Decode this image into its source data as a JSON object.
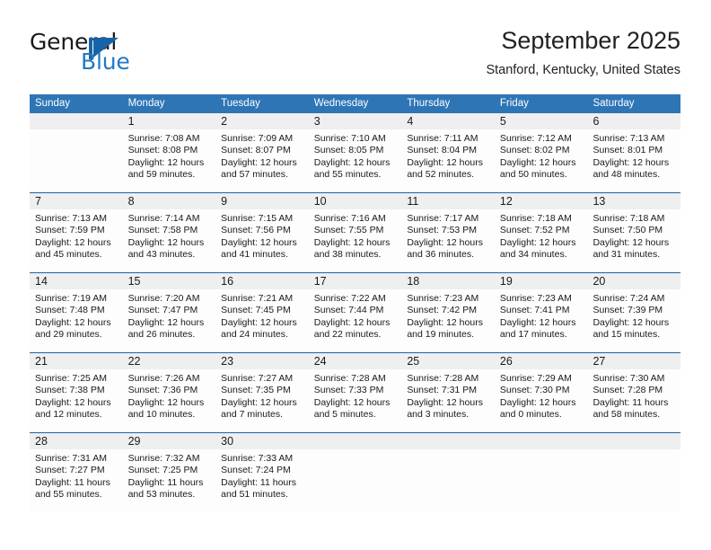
{
  "brand": {
    "name_top": "General",
    "name_bottom": "Blue",
    "accent_color": "#1f7ac4",
    "logo_icon": "blue-triangle-flag-icon"
  },
  "header": {
    "month_title": "September 2025",
    "location": "Stanford, Kentucky, United States"
  },
  "calendar": {
    "header_color": "#2e75b6",
    "daynum_band_color": "#efefef",
    "week_separator_color": "#2360a5",
    "weekdays": [
      "Sunday",
      "Monday",
      "Tuesday",
      "Wednesday",
      "Thursday",
      "Friday",
      "Saturday"
    ],
    "weeks": [
      {
        "days": [
          {
            "num": "",
            "sunrise": "",
            "sunset": "",
            "daylight": ""
          },
          {
            "num": "1",
            "sunrise": "Sunrise: 7:08 AM",
            "sunset": "Sunset: 8:08 PM",
            "daylight": "Daylight: 12 hours and 59 minutes."
          },
          {
            "num": "2",
            "sunrise": "Sunrise: 7:09 AM",
            "sunset": "Sunset: 8:07 PM",
            "daylight": "Daylight: 12 hours and 57 minutes."
          },
          {
            "num": "3",
            "sunrise": "Sunrise: 7:10 AM",
            "sunset": "Sunset: 8:05 PM",
            "daylight": "Daylight: 12 hours and 55 minutes."
          },
          {
            "num": "4",
            "sunrise": "Sunrise: 7:11 AM",
            "sunset": "Sunset: 8:04 PM",
            "daylight": "Daylight: 12 hours and 52 minutes."
          },
          {
            "num": "5",
            "sunrise": "Sunrise: 7:12 AM",
            "sunset": "Sunset: 8:02 PM",
            "daylight": "Daylight: 12 hours and 50 minutes."
          },
          {
            "num": "6",
            "sunrise": "Sunrise: 7:13 AM",
            "sunset": "Sunset: 8:01 PM",
            "daylight": "Daylight: 12 hours and 48 minutes."
          }
        ]
      },
      {
        "days": [
          {
            "num": "7",
            "sunrise": "Sunrise: 7:13 AM",
            "sunset": "Sunset: 7:59 PM",
            "daylight": "Daylight: 12 hours and 45 minutes."
          },
          {
            "num": "8",
            "sunrise": "Sunrise: 7:14 AM",
            "sunset": "Sunset: 7:58 PM",
            "daylight": "Daylight: 12 hours and 43 minutes."
          },
          {
            "num": "9",
            "sunrise": "Sunrise: 7:15 AM",
            "sunset": "Sunset: 7:56 PM",
            "daylight": "Daylight: 12 hours and 41 minutes."
          },
          {
            "num": "10",
            "sunrise": "Sunrise: 7:16 AM",
            "sunset": "Sunset: 7:55 PM",
            "daylight": "Daylight: 12 hours and 38 minutes."
          },
          {
            "num": "11",
            "sunrise": "Sunrise: 7:17 AM",
            "sunset": "Sunset: 7:53 PM",
            "daylight": "Daylight: 12 hours and 36 minutes."
          },
          {
            "num": "12",
            "sunrise": "Sunrise: 7:18 AM",
            "sunset": "Sunset: 7:52 PM",
            "daylight": "Daylight: 12 hours and 34 minutes."
          },
          {
            "num": "13",
            "sunrise": "Sunrise: 7:18 AM",
            "sunset": "Sunset: 7:50 PM",
            "daylight": "Daylight: 12 hours and 31 minutes."
          }
        ]
      },
      {
        "days": [
          {
            "num": "14",
            "sunrise": "Sunrise: 7:19 AM",
            "sunset": "Sunset: 7:48 PM",
            "daylight": "Daylight: 12 hours and 29 minutes."
          },
          {
            "num": "15",
            "sunrise": "Sunrise: 7:20 AM",
            "sunset": "Sunset: 7:47 PM",
            "daylight": "Daylight: 12 hours and 26 minutes."
          },
          {
            "num": "16",
            "sunrise": "Sunrise: 7:21 AM",
            "sunset": "Sunset: 7:45 PM",
            "daylight": "Daylight: 12 hours and 24 minutes."
          },
          {
            "num": "17",
            "sunrise": "Sunrise: 7:22 AM",
            "sunset": "Sunset: 7:44 PM",
            "daylight": "Daylight: 12 hours and 22 minutes."
          },
          {
            "num": "18",
            "sunrise": "Sunrise: 7:23 AM",
            "sunset": "Sunset: 7:42 PM",
            "daylight": "Daylight: 12 hours and 19 minutes."
          },
          {
            "num": "19",
            "sunrise": "Sunrise: 7:23 AM",
            "sunset": "Sunset: 7:41 PM",
            "daylight": "Daylight: 12 hours and 17 minutes."
          },
          {
            "num": "20",
            "sunrise": "Sunrise: 7:24 AM",
            "sunset": "Sunset: 7:39 PM",
            "daylight": "Daylight: 12 hours and 15 minutes."
          }
        ]
      },
      {
        "days": [
          {
            "num": "21",
            "sunrise": "Sunrise: 7:25 AM",
            "sunset": "Sunset: 7:38 PM",
            "daylight": "Daylight: 12 hours and 12 minutes."
          },
          {
            "num": "22",
            "sunrise": "Sunrise: 7:26 AM",
            "sunset": "Sunset: 7:36 PM",
            "daylight": "Daylight: 12 hours and 10 minutes."
          },
          {
            "num": "23",
            "sunrise": "Sunrise: 7:27 AM",
            "sunset": "Sunset: 7:35 PM",
            "daylight": "Daylight: 12 hours and 7 minutes."
          },
          {
            "num": "24",
            "sunrise": "Sunrise: 7:28 AM",
            "sunset": "Sunset: 7:33 PM",
            "daylight": "Daylight: 12 hours and 5 minutes."
          },
          {
            "num": "25",
            "sunrise": "Sunrise: 7:28 AM",
            "sunset": "Sunset: 7:31 PM",
            "daylight": "Daylight: 12 hours and 3 minutes."
          },
          {
            "num": "26",
            "sunrise": "Sunrise: 7:29 AM",
            "sunset": "Sunset: 7:30 PM",
            "daylight": "Daylight: 12 hours and 0 minutes."
          },
          {
            "num": "27",
            "sunrise": "Sunrise: 7:30 AM",
            "sunset": "Sunset: 7:28 PM",
            "daylight": "Daylight: 11 hours and 58 minutes."
          }
        ]
      },
      {
        "days": [
          {
            "num": "28",
            "sunrise": "Sunrise: 7:31 AM",
            "sunset": "Sunset: 7:27 PM",
            "daylight": "Daylight: 11 hours and 55 minutes."
          },
          {
            "num": "29",
            "sunrise": "Sunrise: 7:32 AM",
            "sunset": "Sunset: 7:25 PM",
            "daylight": "Daylight: 11 hours and 53 minutes."
          },
          {
            "num": "30",
            "sunrise": "Sunrise: 7:33 AM",
            "sunset": "Sunset: 7:24 PM",
            "daylight": "Daylight: 11 hours and 51 minutes."
          },
          {
            "num": "",
            "sunrise": "",
            "sunset": "",
            "daylight": ""
          },
          {
            "num": "",
            "sunrise": "",
            "sunset": "",
            "daylight": ""
          },
          {
            "num": "",
            "sunrise": "",
            "sunset": "",
            "daylight": ""
          },
          {
            "num": "",
            "sunrise": "",
            "sunset": "",
            "daylight": ""
          }
        ]
      }
    ]
  }
}
